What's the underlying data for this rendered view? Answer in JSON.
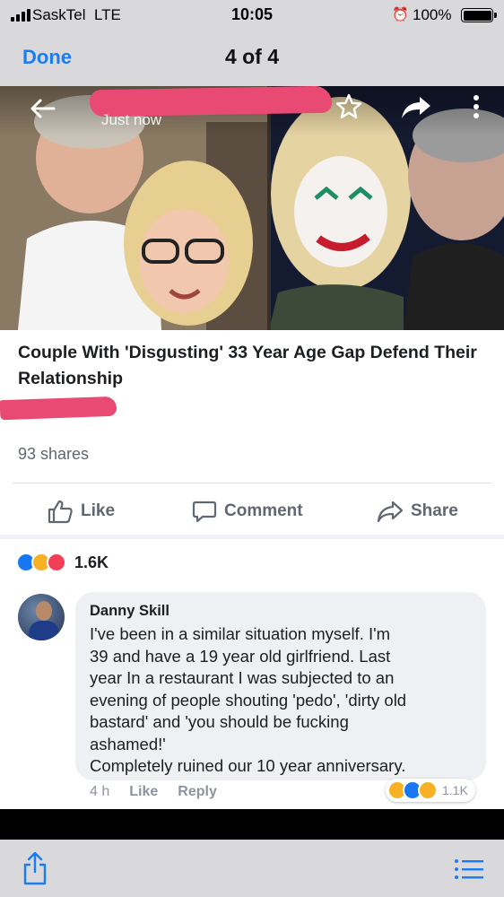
{
  "status_bar": {
    "carrier": "SaskTel",
    "network": "LTE",
    "time": "10:05",
    "battery": "100%",
    "icons": [
      "signal-icon",
      "alarm-icon",
      "battery-icon"
    ]
  },
  "viewer": {
    "done_label": "Done",
    "counter": "4 of 4"
  },
  "post": {
    "timestamp": "Just now",
    "headline": "Couple With 'Disgusting' 33 Year Age Gap Defend Their Relationship",
    "shares": "93 shares",
    "actions": {
      "like": "Like",
      "comment": "Comment",
      "share": "Share"
    },
    "reaction_count": "1.6K",
    "reaction_types": [
      "like",
      "haha",
      "love"
    ]
  },
  "comment": {
    "author": "Danny Skill",
    "text": "I've been in a similar situation  myself. I'm\n39 and have a 19 year old girlfriend. Last\nyear In a restaurant I was subjected to an\nevening of people shouting 'pedo', 'dirty old\nbastard' and 'you should be fucking\nashamed!'\nCompletely ruined our 10 year anniversary.",
    "time": "4 h",
    "like_label": "Like",
    "reply_label": "Reply",
    "reaction_count": "1.1K",
    "reaction_types": [
      "haha",
      "like",
      "wow"
    ]
  },
  "colors": {
    "ios_blue": "#1a7cf5",
    "facebook_blue": "#1877f2",
    "highlight_scribble": "#e84a74"
  }
}
